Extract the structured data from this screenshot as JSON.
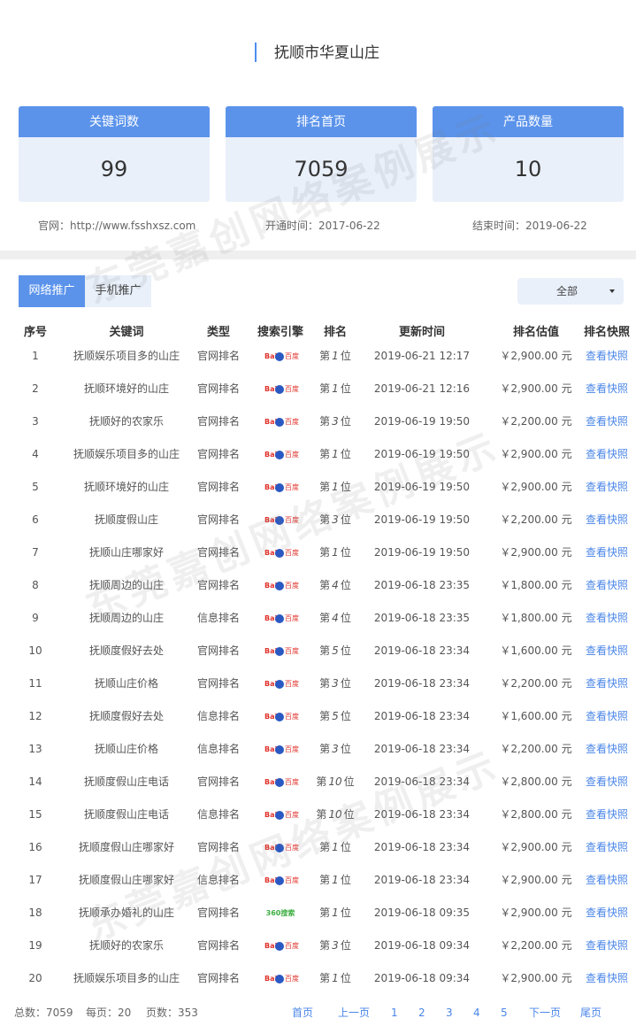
{
  "header": {
    "title": "抚顺市华夏山庄"
  },
  "cards": [
    {
      "label": "关键词数",
      "value": "99"
    },
    {
      "label": "排名首页",
      "value": "7059"
    },
    {
      "label": "产品数量",
      "value": "10"
    }
  ],
  "meta": {
    "website": "官网：http://www.fsshxsz.com",
    "start": "开通时间：2017-06-22",
    "end": "结束时间：2019-06-22"
  },
  "tabs": {
    "network": "网络推广",
    "mobile": "手机推广"
  },
  "filter": {
    "selected": "全部"
  },
  "table": {
    "headers": [
      "序号",
      "关键词",
      "类型",
      "搜索引擎",
      "排名",
      "更新时间",
      "排名估值",
      "排名快照"
    ],
    "rank_prefix": "第",
    "rank_suffix": "位",
    "snapshot_label": "查看快照",
    "rows": [
      {
        "idx": "1",
        "keyword": "抚顺娱乐项目多的山庄",
        "type": "官网排名",
        "engine": "baidu",
        "rank": "1",
        "time": "2019-06-21 12:17",
        "price": "￥2,900.00 元"
      },
      {
        "idx": "2",
        "keyword": "抚顺环境好的山庄",
        "type": "官网排名",
        "engine": "baidu",
        "rank": "1",
        "time": "2019-06-21 12:16",
        "price": "￥2,900.00 元"
      },
      {
        "idx": "3",
        "keyword": "抚顺好的农家乐",
        "type": "官网排名",
        "engine": "baidu",
        "rank": "3",
        "time": "2019-06-19 19:50",
        "price": "￥2,200.00 元"
      },
      {
        "idx": "4",
        "keyword": "抚顺娱乐项目多的山庄",
        "type": "官网排名",
        "engine": "baidu",
        "rank": "1",
        "time": "2019-06-19 19:50",
        "price": "￥2,900.00 元"
      },
      {
        "idx": "5",
        "keyword": "抚顺环境好的山庄",
        "type": "官网排名",
        "engine": "baidu",
        "rank": "1",
        "time": "2019-06-19 19:50",
        "price": "￥2,900.00 元"
      },
      {
        "idx": "6",
        "keyword": "抚顺度假山庄",
        "type": "官网排名",
        "engine": "baidu",
        "rank": "3",
        "time": "2019-06-19 19:50",
        "price": "￥2,200.00 元"
      },
      {
        "idx": "7",
        "keyword": "抚顺山庄哪家好",
        "type": "官网排名",
        "engine": "baidu",
        "rank": "1",
        "time": "2019-06-19 19:50",
        "price": "￥2,900.00 元"
      },
      {
        "idx": "8",
        "keyword": "抚顺周边的山庄",
        "type": "官网排名",
        "engine": "baidu",
        "rank": "4",
        "time": "2019-06-18 23:35",
        "price": "￥1,800.00 元"
      },
      {
        "idx": "9",
        "keyword": "抚顺周边的山庄",
        "type": "信息排名",
        "engine": "baidu",
        "rank": "4",
        "time": "2019-06-18 23:35",
        "price": "￥1,800.00 元"
      },
      {
        "idx": "10",
        "keyword": "抚顺度假好去处",
        "type": "官网排名",
        "engine": "baidu",
        "rank": "5",
        "time": "2019-06-18 23:34",
        "price": "￥1,600.00 元"
      },
      {
        "idx": "11",
        "keyword": "抚顺山庄价格",
        "type": "官网排名",
        "engine": "baidu",
        "rank": "3",
        "time": "2019-06-18 23:34",
        "price": "￥2,200.00 元"
      },
      {
        "idx": "12",
        "keyword": "抚顺度假好去处",
        "type": "信息排名",
        "engine": "baidu",
        "rank": "5",
        "time": "2019-06-18 23:34",
        "price": "￥1,600.00 元"
      },
      {
        "idx": "13",
        "keyword": "抚顺山庄价格",
        "type": "信息排名",
        "engine": "baidu",
        "rank": "3",
        "time": "2019-06-18 23:34",
        "price": "￥2,200.00 元"
      },
      {
        "idx": "14",
        "keyword": "抚顺度假山庄电话",
        "type": "官网排名",
        "engine": "baidu",
        "rank": "10",
        "time": "2019-06-18 23:34",
        "price": "￥2,800.00 元"
      },
      {
        "idx": "15",
        "keyword": "抚顺度假山庄电话",
        "type": "信息排名",
        "engine": "baidu",
        "rank": "10",
        "time": "2019-06-18 23:34",
        "price": "￥2,800.00 元"
      },
      {
        "idx": "16",
        "keyword": "抚顺度假山庄哪家好",
        "type": "官网排名",
        "engine": "baidu",
        "rank": "1",
        "time": "2019-06-18 23:34",
        "price": "￥2,900.00 元"
      },
      {
        "idx": "17",
        "keyword": "抚顺度假山庄哪家好",
        "type": "信息排名",
        "engine": "baidu",
        "rank": "1",
        "time": "2019-06-18 23:34",
        "price": "￥2,900.00 元"
      },
      {
        "idx": "18",
        "keyword": "抚顺承办婚礼的山庄",
        "type": "官网排名",
        "engine": "360",
        "rank": "1",
        "time": "2019-06-18 09:35",
        "price": "￥2,900.00 元"
      },
      {
        "idx": "19",
        "keyword": "抚顺好的农家乐",
        "type": "官网排名",
        "engine": "baidu",
        "rank": "3",
        "time": "2019-06-18 09:34",
        "price": "￥2,200.00 元"
      },
      {
        "idx": "20",
        "keyword": "抚顺娱乐项目多的山庄",
        "type": "官网排名",
        "engine": "baidu",
        "rank": "1",
        "time": "2019-06-18 09:34",
        "price": "￥2,900.00 元"
      }
    ]
  },
  "engines": {
    "baidu": {
      "left": "Bai",
      "right": "百度",
      "icon": "baidu-logo-icon"
    },
    "360": {
      "text": "360搜索",
      "icon": "360-search-logo-icon"
    }
  },
  "footer": {
    "total": "总数：7059",
    "per_page": "每页：20",
    "pages": "页数：353",
    "pager": [
      "首页",
      "上一页",
      "1",
      "2",
      "3",
      "4",
      "5",
      "下一页",
      "尾页"
    ]
  },
  "watermark": {
    "text": "东莞嘉创网络案例展示"
  },
  "colors": {
    "accent": "#5b93eb",
    "card_bg": "#e9f0fa",
    "link": "#4a86e8",
    "baidu_red": "#e0322b",
    "baidu_blue": "#2b59c3",
    "green_360": "#3dae41"
  }
}
